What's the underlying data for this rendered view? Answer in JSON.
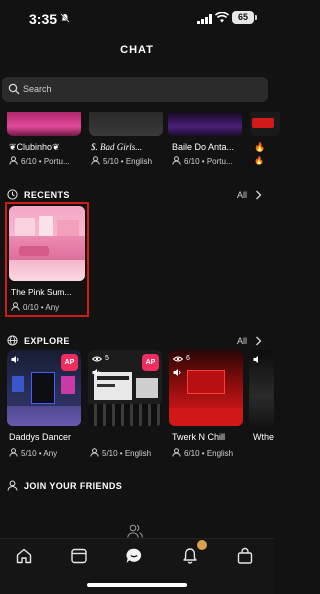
{
  "status_bar": {
    "time": "3:35",
    "battery": "65"
  },
  "header": {
    "title": "CHAT"
  },
  "search": {
    "placeholder": "Search"
  },
  "top_row": [
    {
      "name": "❦Clubinho❦",
      "meta": "6/10 • Portu..."
    },
    {
      "name": "$. Bad Girls...",
      "meta": "5/10 • English"
    },
    {
      "name": "Baile Do Anta...",
      "meta": "6/10 • Portu..."
    },
    {
      "name": "🔥",
      "meta": "🔥"
    }
  ],
  "recents": {
    "title": "RECENTS",
    "all_label": "All",
    "items": [
      {
        "name": "The Pink Sum...",
        "meta": "0/10 • Any"
      }
    ]
  },
  "explore": {
    "title": "EXPLORE",
    "all_label": "All",
    "items": [
      {
        "name": "Daddys Dancer",
        "meta": "5/10 • Any",
        "views": "",
        "badge": "AP"
      },
      {
        "name": "",
        "meta": "5/10 • English",
        "views": "5",
        "badge": "AP"
      },
      {
        "name": "Twerk N Chill",
        "meta": "6/10 • English",
        "views": "6",
        "badge": ""
      },
      {
        "name": "Wthe",
        "meta": "",
        "views": "",
        "badge": ""
      }
    ]
  },
  "join": {
    "title": "JOIN YOUR FRIENDS"
  },
  "colors": {
    "accent_red": "#d11a1a",
    "ap_badge": "#ef2d5e",
    "notification_dot": "#d9a24a"
  }
}
